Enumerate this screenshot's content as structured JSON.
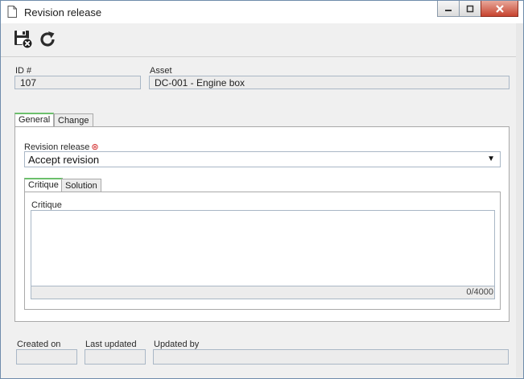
{
  "window": {
    "title": "Revision release",
    "controls": [
      "minimize",
      "maximize",
      "close"
    ]
  },
  "toolbar": {
    "buttons": [
      {
        "name": "save-and-close",
        "icon": "save-close-icon"
      },
      {
        "name": "refresh",
        "icon": "refresh-icon"
      }
    ]
  },
  "header": {
    "id_label": "ID #",
    "id_value": "107",
    "asset_label": "Asset",
    "asset_value": "DC-001 - Engine box"
  },
  "tabs": [
    {
      "label": "General",
      "active": true
    },
    {
      "label": "Change",
      "active": false
    }
  ],
  "general": {
    "revision_release_label": "Revision release",
    "revision_release_value": "Accept revision",
    "subtabs": [
      {
        "label": "Critique",
        "active": true
      },
      {
        "label": "Solution",
        "active": false
      }
    ],
    "critique_label": "Critique",
    "critique_value": "",
    "counter": "0/4000"
  },
  "footer": {
    "created_on_label": "Created on",
    "created_on_value": "",
    "last_updated_label": "Last updated",
    "last_updated_value": "",
    "updated_by_label": "Updated by",
    "updated_by_value": ""
  },
  "colors": {
    "active_tab_accent": "#6cc06c",
    "required_marker": "#d02020",
    "close_button": "#c7432f"
  }
}
